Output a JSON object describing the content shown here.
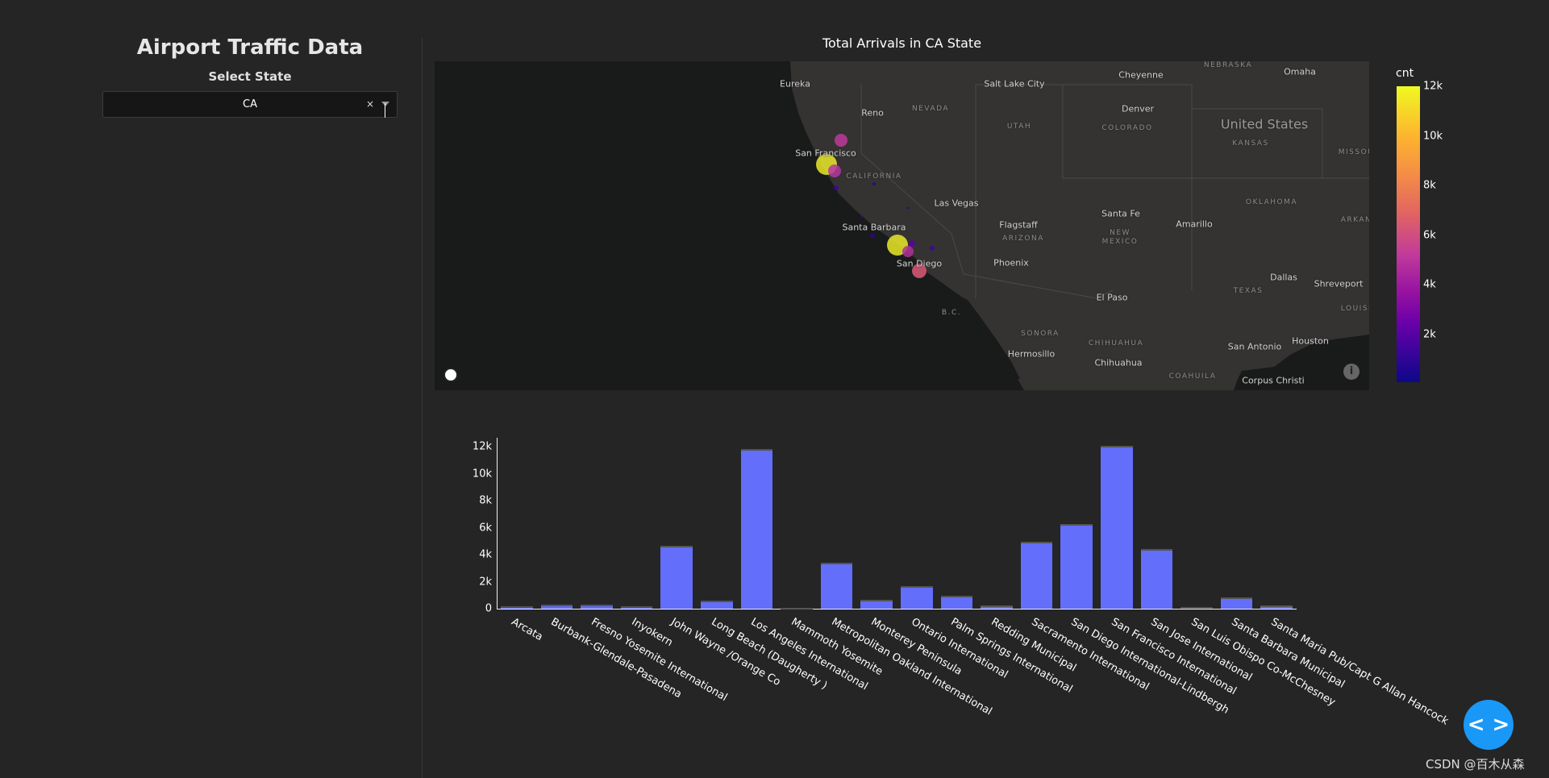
{
  "sidebar": {
    "title": "Airport Traffic Data",
    "select_label": "Select State",
    "select_value": "CA",
    "clear_icon": "×"
  },
  "map": {
    "title": "Total Arrivals in CA State",
    "labels": [
      "Eureka",
      "Reno",
      "San Francisco",
      "Las Vegas",
      "Santa Barbara",
      "San Diego",
      "Salt Lake City",
      "Cheyenne",
      "Denver",
      "Omaha",
      "Santa Fe",
      "Amarillo",
      "Flagstaff",
      "Phoenix",
      "Dallas",
      "Shreveport",
      "El Paso",
      "Houston",
      "San Antonio",
      "Hermosillo",
      "Chihuahua",
      "Corpus Christi"
    ],
    "regions": [
      "NEVADA",
      "CALIFORNIA",
      "UTAH",
      "COLORADO",
      "NEBRASKA",
      "KANSAS",
      "MISSOU",
      "OKLAHOMA",
      "ARKAN",
      "NEW",
      "MEXICO",
      "ARIZONA",
      "TEXAS",
      "LOUISI",
      "B.C.",
      "SONORA",
      "CHIHUAHUA",
      "COAHUILA"
    ],
    "country": "United States",
    "colorbar": {
      "title": "cnt",
      "ticks": [
        "2k",
        "4k",
        "6k",
        "8k",
        "10k",
        "12k"
      ],
      "colorscale": "plasma",
      "range": [
        0,
        12000
      ]
    }
  },
  "chart_data": {
    "type": "bar",
    "categories": [
      "Arcata",
      "Burbank-Glendale-Pasadena",
      "Fresno Yosemite International",
      "Inyokern",
      "John Wayne /Orange Co",
      "Long Beach (Daugherty )",
      "Los Angeles International",
      "Mammoth Yosemite",
      "Metropolitan Oakland International",
      "Monterey Peninsula",
      "Ontario International",
      "Palm Springs International",
      "Redding Municipal",
      "Sacramento International",
      "San Diego International-Lindbergh",
      "San Francisco International",
      "San Jose International",
      "San Luis Obispo Co-McChesney",
      "Santa Barbara Municipal",
      "Santa Maria Pub/Capt G Allan Hancock"
    ],
    "values": [
      150,
      300,
      280,
      180,
      4640,
      580,
      11840,
      80,
      3420,
      680,
      1650,
      980,
      260,
      4970,
      6270,
      12060,
      4400,
      140,
      840,
      260
    ],
    "yticks": [
      "0",
      "2k",
      "4k",
      "6k",
      "8k",
      "10k",
      "12k"
    ],
    "ylim": [
      0,
      12000
    ],
    "bar_color": "#636efa",
    "xlabel": "",
    "ylabel": ""
  },
  "footer": {
    "code_button": "< >",
    "watermark": "CSDN @百木从森"
  }
}
